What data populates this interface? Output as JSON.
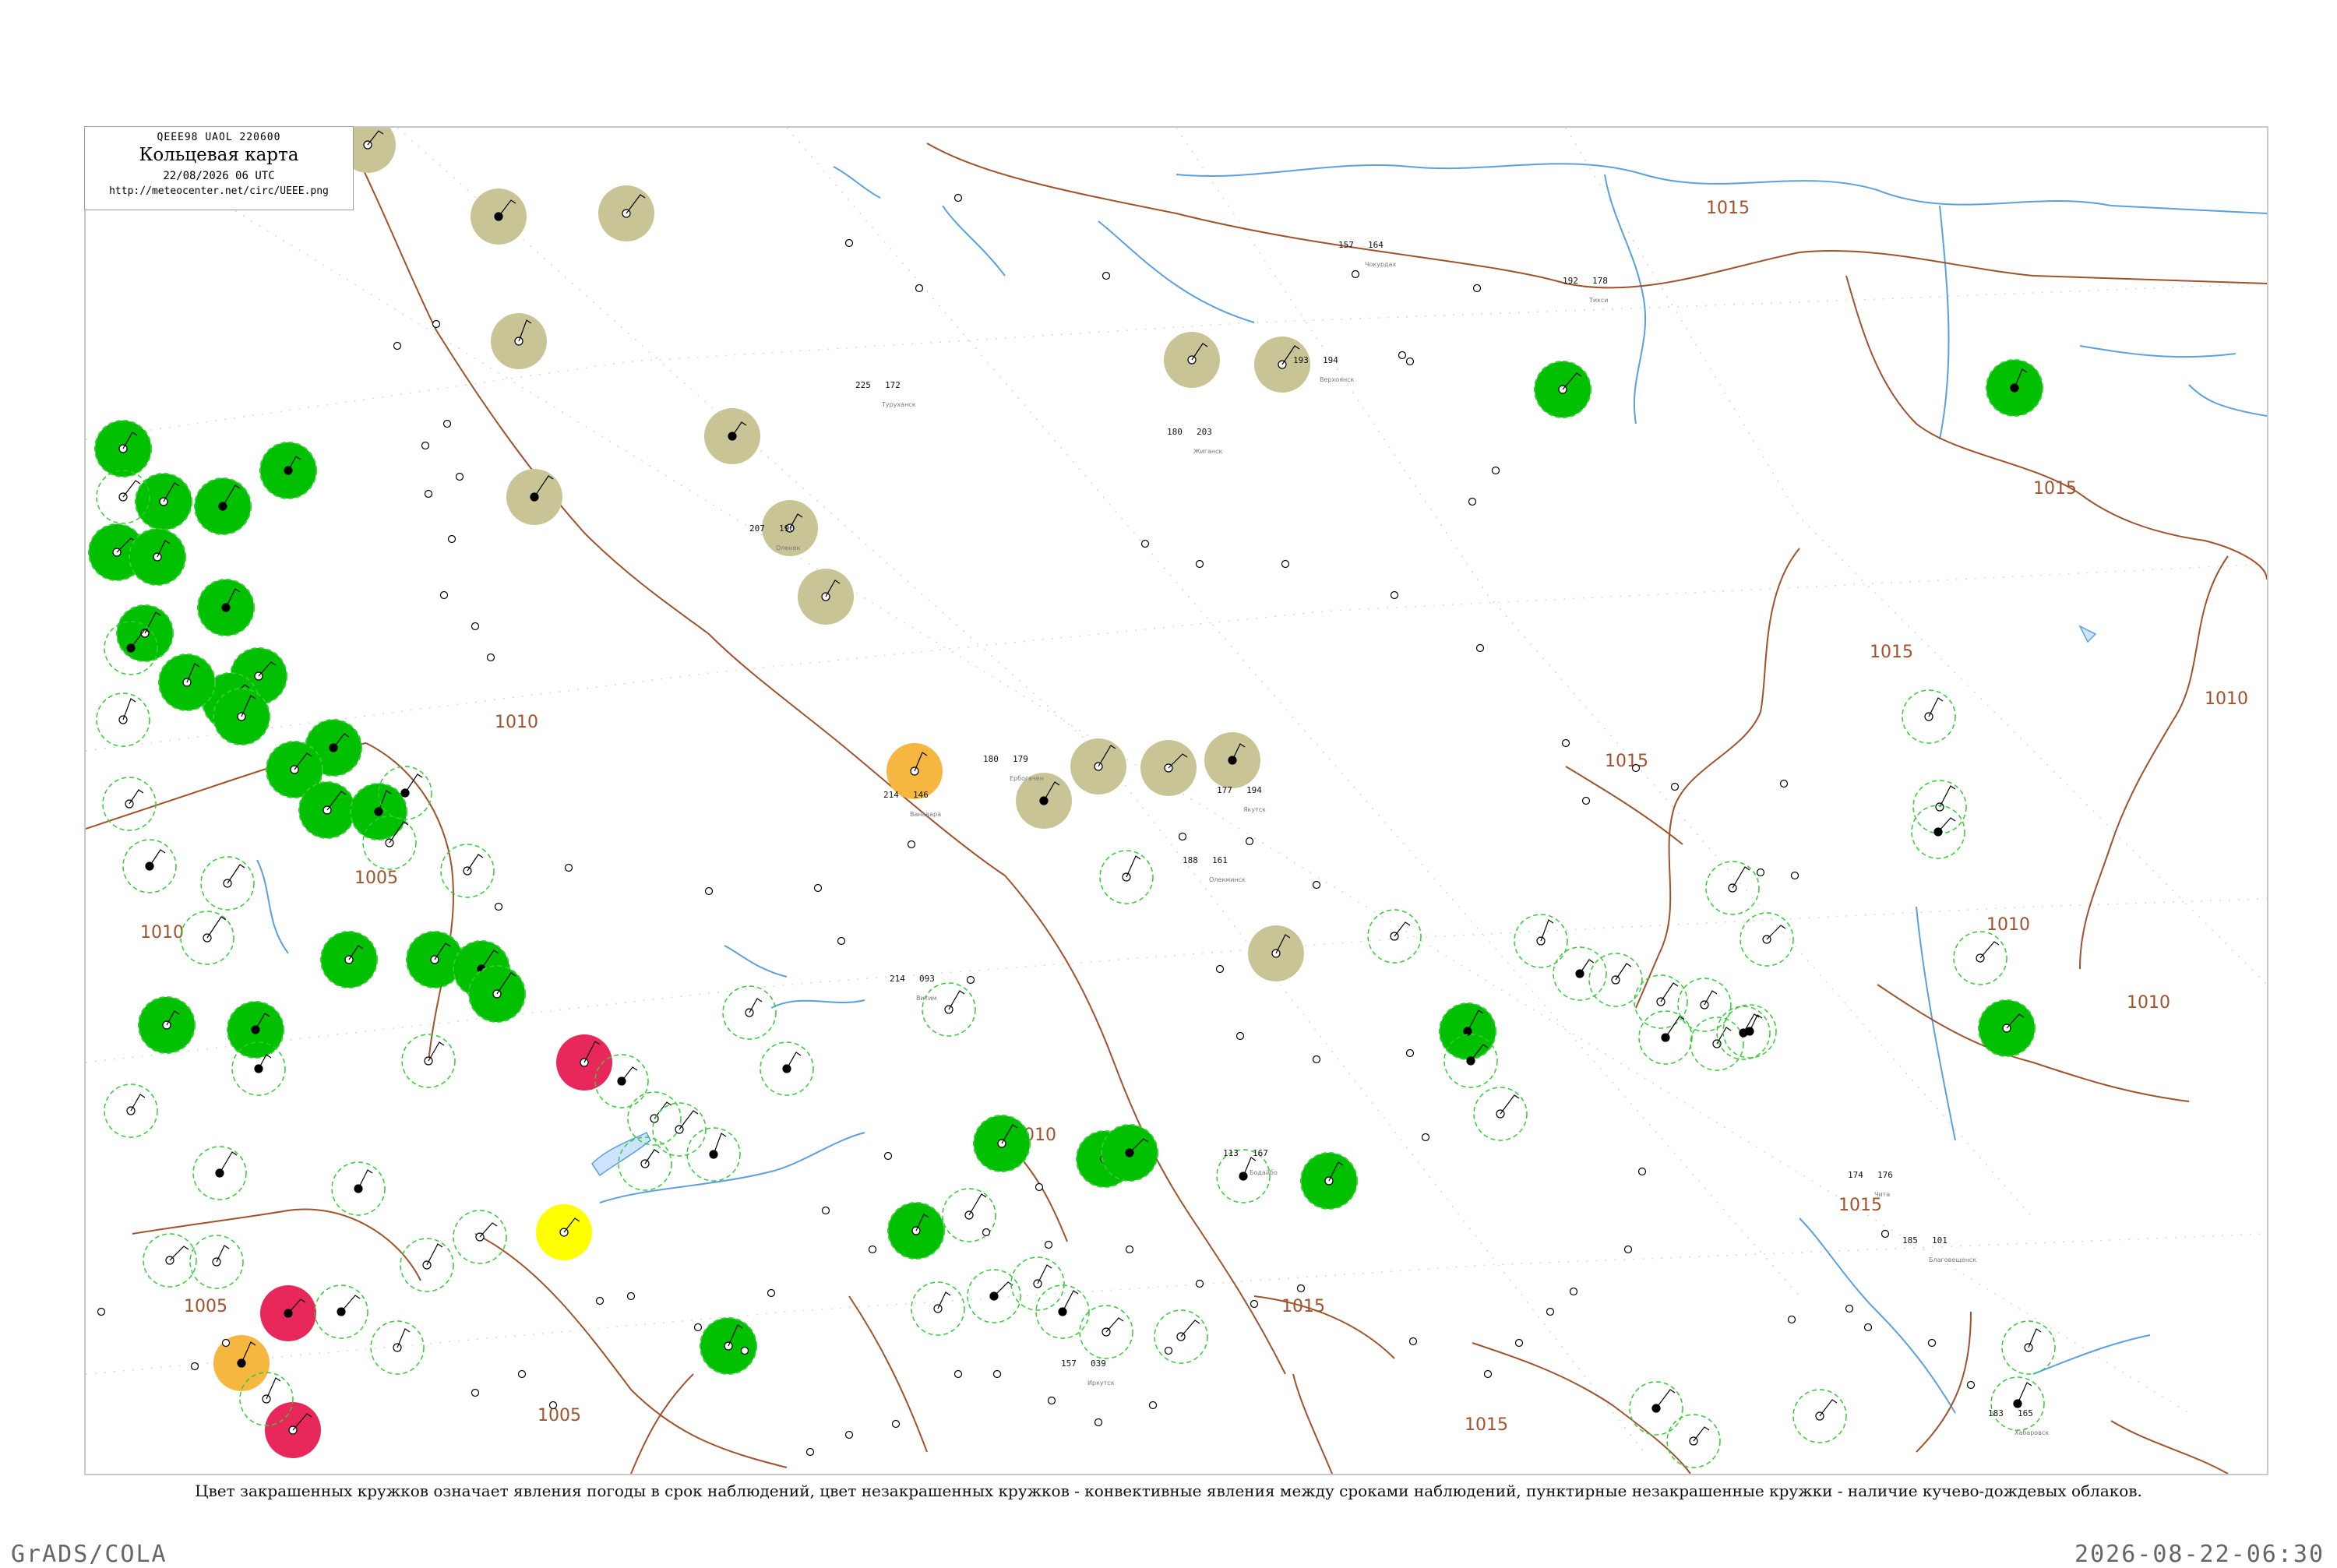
{
  "header": {
    "code": "QEEE98  UAOL  220600",
    "title": "Кольцевая карта",
    "time": "22/08/2026 06 UTC",
    "url": "http://meteocenter.net/circ/UEEE.png"
  },
  "caption": "Цвет закрашенных кружков означает явления погоды в срок наблюдений, цвет незакрашенных кружков - конвективные явления между сроками наблюдений, пунктирные незакрашенные кружки - наличие кучево-дождевых облаков.",
  "footer": {
    "left": "GrADS/COLA",
    "right": "2026-08-22-06:30"
  },
  "colors": {
    "isobar": "#a0522d",
    "river": "#5aa0e0",
    "green_fill": "#00c000",
    "olive_fill": "#c8c496",
    "red_fill": "#e8285a",
    "orange_fill": "#f5b740",
    "yellow_fill": "#ffff00",
    "cb_dashed": "#33cc33"
  },
  "isobar_labels": [
    "1015",
    "1015",
    "1015",
    "1015",
    "1010",
    "1010",
    "1010",
    "1010",
    "1010",
    "1005",
    "1005",
    "1005",
    "1010",
    "1015",
    "1015",
    "1015"
  ],
  "stations": [
    {
      "name": "Тикси",
      "t": "192",
      "p": "178"
    },
    {
      "name": "Чокурдах",
      "t": "157",
      "p": "164"
    },
    {
      "name": "Верхоянск",
      "t": "193",
      "p": "194"
    },
    {
      "name": "Жиганск",
      "t": "180",
      "p": "203"
    },
    {
      "name": "Оленек",
      "t": "207",
      "p": "190"
    },
    {
      "name": "Туруханск",
      "t": "225",
      "p": "172"
    },
    {
      "name": "Ванавара",
      "t": "214",
      "p": "146"
    },
    {
      "name": "Ербогачен",
      "t": "180",
      "p": "179"
    },
    {
      "name": "Якутск",
      "t": "177",
      "p": "194"
    },
    {
      "name": "Олекминск",
      "t": "188",
      "p": "161"
    },
    {
      "name": "Витим",
      "t": "214",
      "p": "093"
    },
    {
      "name": "Бодайбо",
      "t": "113",
      "p": "167"
    },
    {
      "name": "Иркутск",
      "t": "157",
      "p": "039"
    },
    {
      "name": "Чита",
      "t": "174",
      "p": "176"
    },
    {
      "name": "Благовещенск",
      "t": "185",
      "p": "101"
    },
    {
      "name": "Хабаровск",
      "t": "183",
      "p": "165"
    }
  ]
}
